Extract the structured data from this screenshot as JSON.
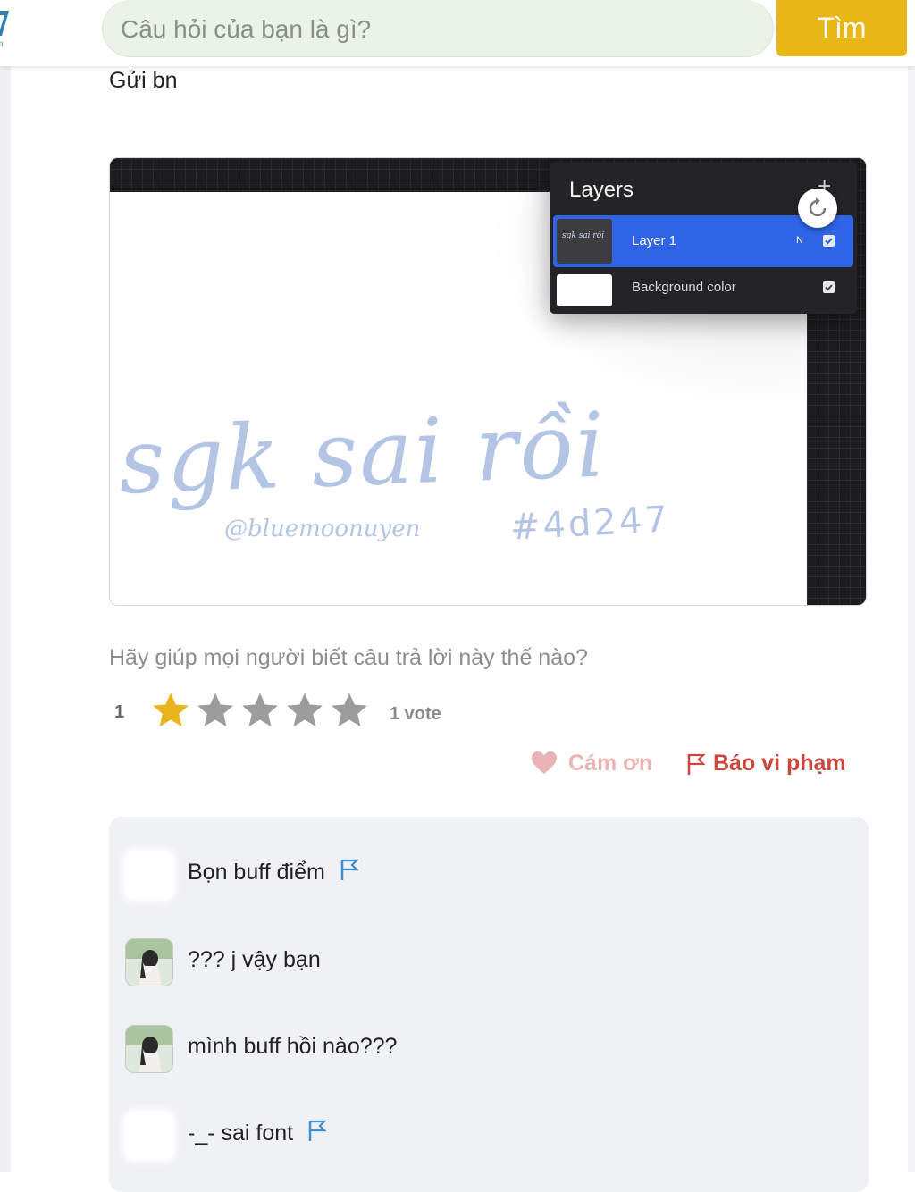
{
  "header": {
    "search_placeholder": "Câu hỏi của bạn là gì?",
    "search_button": "Tìm",
    "accent": "#e7b617"
  },
  "answer": {
    "text": "Gửi bn",
    "image": {
      "panel_title": "Layers",
      "layers": [
        {
          "name": "Layer 1",
          "mode": "N",
          "thumb_text": "sgk sai rồi"
        },
        {
          "name": "Background color"
        }
      ],
      "lettering": "sgk sai rồi",
      "handle": "@bluemoonuyen",
      "hex": "#4d247"
    }
  },
  "rating": {
    "prompt": "Hãy giúp mọi người biết câu trả lời này thế nào?",
    "value": "1",
    "stars_filled": 1,
    "stars_total": 5,
    "votes": "1 vote"
  },
  "actions": {
    "thanks": "Cám ơn",
    "report": "Báo vi phạm"
  },
  "comments": [
    {
      "text": "Bọn buff điểm",
      "avatar": "blank",
      "flag": true
    },
    {
      "text": "??? j vậy bạn",
      "avatar": "photo",
      "flag": false
    },
    {
      "text": "mình buff hồi nào???",
      "avatar": "photo",
      "flag": false
    },
    {
      "text": "-_- sai font",
      "avatar": "blank",
      "flag": true
    }
  ]
}
